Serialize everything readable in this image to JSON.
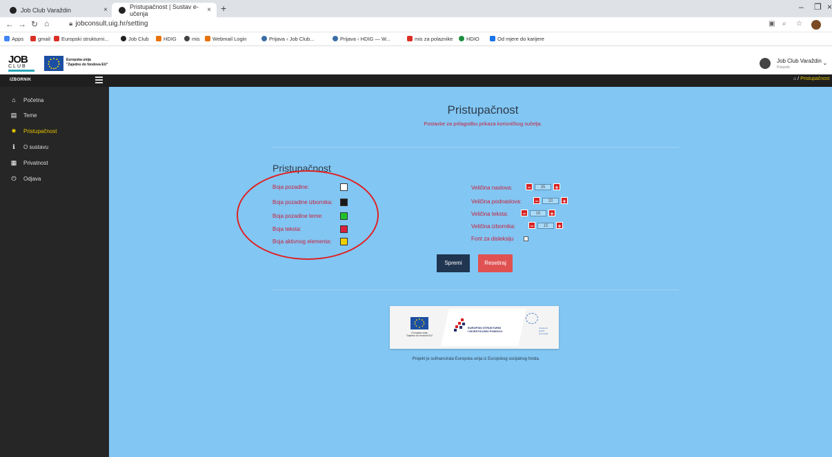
{
  "browser": {
    "tabs": [
      {
        "title": "Job Club Varaždin"
      },
      {
        "title": "Pristupačnost | Sustav e-učenja"
      }
    ],
    "new_tab": "+",
    "close": "×",
    "url": "jobconsult.uig.hr/setting",
    "bookmarks": [
      {
        "label": "Apps",
        "color": "#4285f4"
      },
      {
        "label": "gmail",
        "color": "#d93025"
      },
      {
        "label": "Europski strukturni...",
        "color": "#d93025"
      },
      {
        "label": "Job Club",
        "color": "#222222"
      },
      {
        "label": "HDIG",
        "color": "#e8710a"
      },
      {
        "label": "mis",
        "color": "#444444"
      },
      {
        "label": "Webmail Login",
        "color": "#e8710a"
      },
      {
        "label": "Prijava ‹ Job Club...",
        "color": "#3a6ea5"
      },
      {
        "label": "Prijava ‹ HDIG — W...",
        "color": "#3a6ea5"
      },
      {
        "label": "mis za polaznike",
        "color": "#d93025"
      },
      {
        "label": "HDIO",
        "color": "#1e8e3e"
      },
      {
        "label": "Od mjere do karijere",
        "color": "#1a73e8"
      }
    ]
  },
  "header": {
    "logo_job": "JOB",
    "logo_club": "CLUB",
    "eu_line1": "Europska unija",
    "eu_line2": "\"Zajedno do fondova EU\"",
    "user_name": "Job Club Varaždin",
    "user_role": "Polaznik"
  },
  "topbar": {
    "menu_label": "IZBORNIK",
    "breadcrumb_current": "Pristupačnost"
  },
  "sidebar": {
    "items": [
      {
        "label": "Početna",
        "icon": "home-icon",
        "glyph": "⌂"
      },
      {
        "label": "Teme",
        "icon": "file-icon",
        "glyph": "▤"
      },
      {
        "label": "Pristupačnost",
        "icon": "gear-icon",
        "glyph": "✹"
      },
      {
        "label": "O sustavu",
        "icon": "info-icon",
        "glyph": "ℹ"
      },
      {
        "label": "Privatnost",
        "icon": "document-icon",
        "glyph": "▦"
      },
      {
        "label": "Odjava",
        "icon": "power-icon",
        "glyph": "⏻"
      }
    ]
  },
  "main": {
    "title": "Pristupačnost",
    "subtitle": "Postavke za prilagodbu prikaza korisničkog sučelja.",
    "section_title": "Pristupačnost",
    "colors": [
      {
        "label": "Boja pozadine:",
        "value": "#ffffff"
      },
      {
        "label": "Boja pozadine izbornika:",
        "value": "#1a1a1a"
      },
      {
        "label": "Boja pozadine teme:",
        "value": "#22c02a"
      },
      {
        "label": "Boja teksta:",
        "value": "#d8203a"
      },
      {
        "label": "Boja aktivnog elementa:",
        "value": "#f2d000"
      }
    ],
    "sizes": [
      {
        "label": "Veličina naslova:",
        "value": "35"
      },
      {
        "label": "Veličina podnaslova:",
        "value": "20"
      },
      {
        "label": "Veličina teksta:",
        "value": "16"
      },
      {
        "label": "Veličina izbornika:",
        "value": "15"
      }
    ],
    "dyslexia_label": "Font za disleksiju",
    "save_label": "Spremi",
    "reset_label": "Resetiraj"
  },
  "footer": {
    "eu_caption_1": "Europska unija",
    "eu_caption_2": "\"Zajedno do fondova EU\"",
    "esi_1": "EUROPSKI STRUKTURNI",
    "esi_2": "I INVESTICIJSKI FONDOVI",
    "ljp_1": "Učinkoviti",
    "ljp_2": "ljudski",
    "ljp_3": "potencijali",
    "note": "Projekt je sufinancirala Europska unija iz Europskog socijalnog fonda."
  }
}
